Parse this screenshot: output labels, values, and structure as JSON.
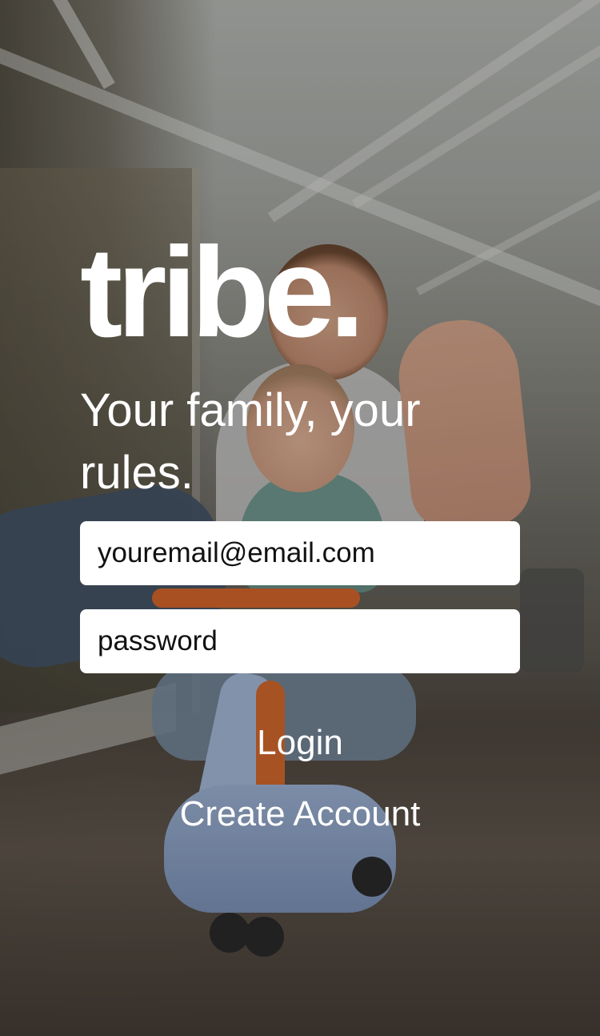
{
  "app": {
    "logo_text": "tribe.",
    "tagline": "Your family, your rules."
  },
  "login_form": {
    "email_placeholder": "youremail@email.com",
    "password_placeholder": "password",
    "login_label": "Login",
    "create_account_label": "Create Account"
  },
  "colors": {
    "text": "#ffffff",
    "field_background": "#ffffff",
    "field_text": "#111111"
  }
}
